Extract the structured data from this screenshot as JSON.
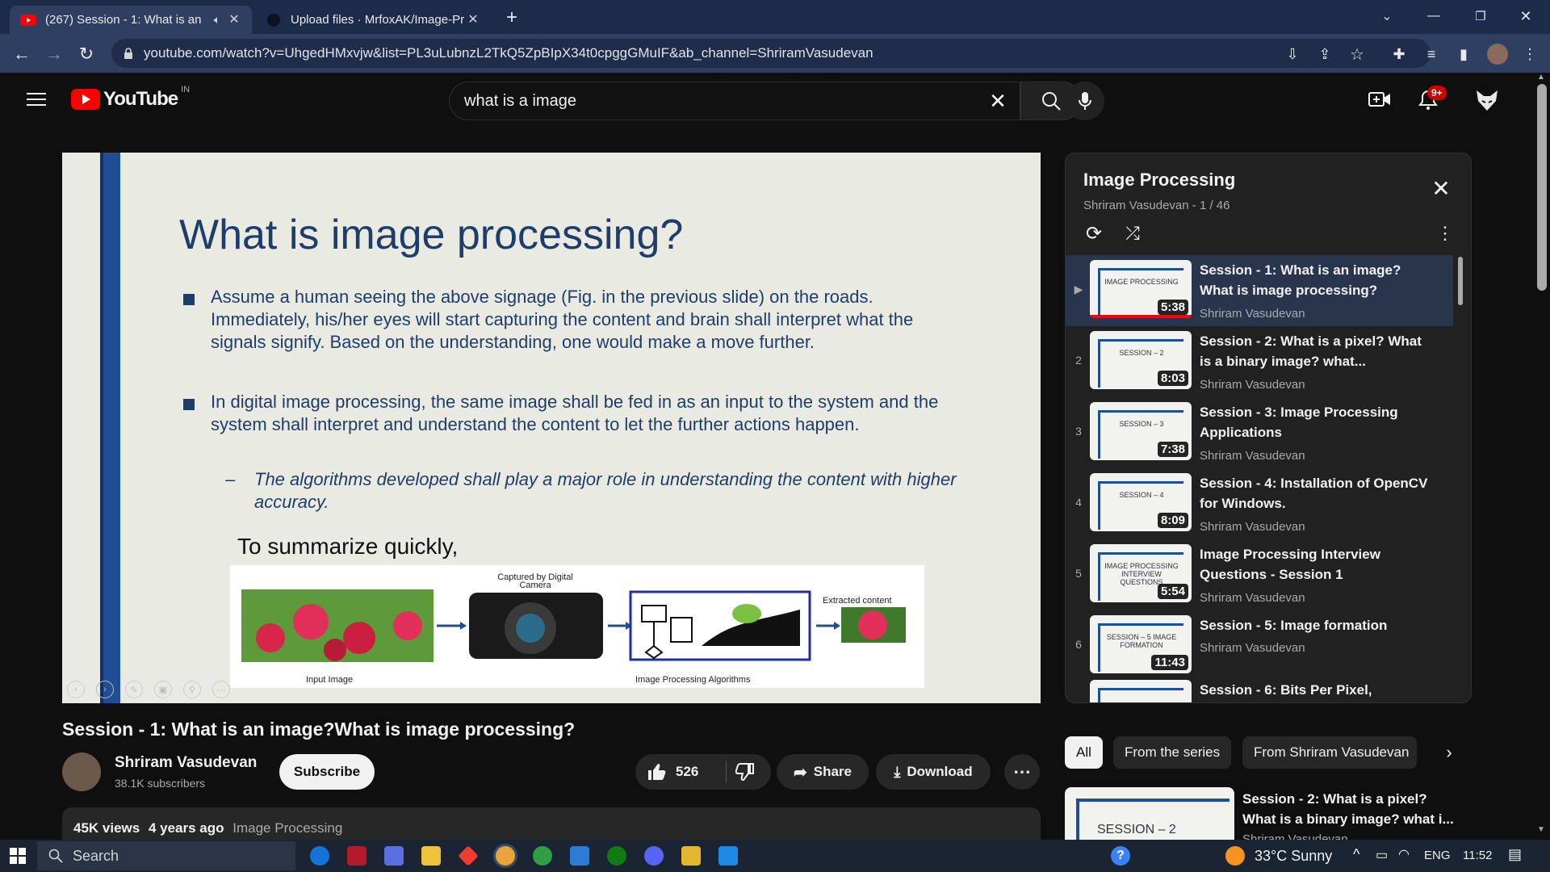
{
  "browser": {
    "tabs": [
      {
        "label": "(267) Session - 1: What is an",
        "active": true
      },
      {
        "label": "Upload files · MrfoxAK/Image-Pr",
        "active": false
      }
    ],
    "url": "youtube.com/watch?v=UhgedHMxvjw&list=PL3uLubnzL2TkQ5ZpBIpX34t0cpggGMuIF&ab_channel=ShriramVasudevan"
  },
  "youtube": {
    "logo": "YouTube",
    "region": "IN",
    "search_value": "what is a image",
    "notif_badge": "9+",
    "slide": {
      "title": "What is image processing?",
      "bullets": [
        "Assume a human seeing the above signage (Fig. in the previous slide) on the roads. Immediately, his/her eyes will start capturing the content and brain shall interpret what the signals signify. Based on the understanding, one would make a move further.",
        "In digital image processing, the same image shall be fed in as an input to the system and the system shall interpret and understand the content to let the further actions happen."
      ],
      "sub_bullet": "The algorithms developed shall play a major role in understanding the content with higher accuracy.",
      "summary": "To summarize quickly,",
      "captions": {
        "input": "Input Image",
        "camera": "Captured by Digital Camera",
        "algo": "Image Processing Algorithms",
        "extract": "Extracted content"
      }
    },
    "video_title": "Session - 1: What is an image?What is image processing?",
    "channel": {
      "name": "Shriram Vasudevan",
      "subs": "38.1K subscribers",
      "subscribe": "Subscribe"
    },
    "actions": {
      "likes": "526",
      "share": "Share",
      "download": "Download"
    },
    "desc": {
      "views": "45K views",
      "age": "4 years ago",
      "tag": "Image Processing"
    },
    "playlist": {
      "title": "Image Processing",
      "meta": "Shriram Vasudevan - 1 / 46",
      "items": [
        {
          "idx": "▶",
          "title": "Session - 1: What is an image?What is image processing?",
          "channel": "Shriram Vasudevan",
          "dur": "5:38",
          "thumb": "IMAGE PROCESSING"
        },
        {
          "idx": "2",
          "title": "Session - 2: What is a pixel? What is a binary image? what...",
          "channel": "Shriram Vasudevan",
          "dur": "8:03",
          "thumb": "SESSION – 2"
        },
        {
          "idx": "3",
          "title": "Session - 3: Image Processing Applications",
          "channel": "Shriram Vasudevan",
          "dur": "7:38",
          "thumb": "SESSION – 3"
        },
        {
          "idx": "4",
          "title": "Session - 4: Installation of OpenCV for Windows.",
          "channel": "Shriram Vasudevan",
          "dur": "8:09",
          "thumb": "SESSION – 4"
        },
        {
          "idx": "5",
          "title": "Image Processing Interview Questions - Session 1",
          "channel": "Shriram Vasudevan",
          "dur": "5:54",
          "thumb": "IMAGE PROCESSING INTERVIEW QUESTIONS"
        },
        {
          "idx": "6",
          "title": "Session - 5: Image formation",
          "channel": "Shriram Vasudevan",
          "dur": "11:43",
          "thumb": "SESSION – 5 IMAGE FORMATION"
        },
        {
          "idx": "",
          "title": "Session - 6: Bits Per Pixel,",
          "channel": "",
          "dur": "",
          "thumb": ""
        }
      ]
    },
    "chips": [
      "All",
      "From the series",
      "From Shriram Vasudevan"
    ],
    "rec": {
      "title": "Session - 2: What is a pixel? What is a binary image? what i...",
      "thumb": "SESSION – 2",
      "channel": "Shriram Vasudevan"
    }
  },
  "taskbar": {
    "search": "Search",
    "weather": "33°C Sunny",
    "lang": "ENG",
    "time": "11:52"
  }
}
